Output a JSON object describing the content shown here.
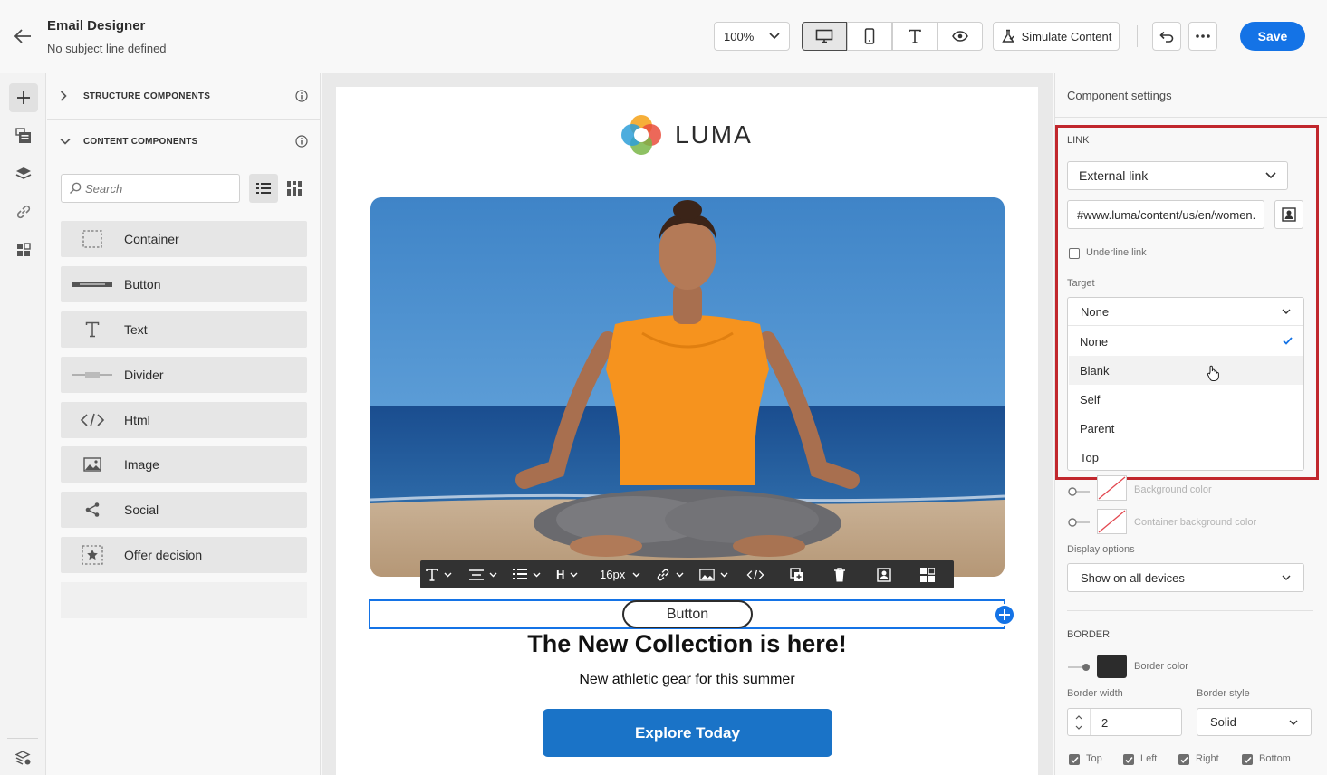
{
  "header": {
    "title": "Email Designer",
    "subtitle": "No subject line defined",
    "zoom": "100%",
    "simulate_label": "Simulate Content",
    "save_label": "Save"
  },
  "components_panel": {
    "structure_title": "STRUCTURE COMPONENTS",
    "content_title": "CONTENT COMPONENTS",
    "search_placeholder": "Search",
    "items": [
      {
        "label": "Container",
        "icon": "container-icon"
      },
      {
        "label": "Button",
        "icon": "button-icon"
      },
      {
        "label": "Text",
        "icon": "text-icon"
      },
      {
        "label": "Divider",
        "icon": "divider-icon"
      },
      {
        "label": "Html",
        "icon": "code-icon"
      },
      {
        "label": "Image",
        "icon": "image-icon"
      },
      {
        "label": "Social",
        "icon": "share-icon"
      },
      {
        "label": "Offer decision",
        "icon": "offer-icon"
      }
    ]
  },
  "email": {
    "brand": "LUMA",
    "button_text": "Button",
    "headline": "The New Collection is here!",
    "subline": "New athletic gear for this summer",
    "cta": "Explore Today",
    "toolbar_font_size": "16px",
    "toolbar_heading": "H"
  },
  "settings": {
    "panel_title": "Component settings",
    "link_section": "LINK",
    "link_type": "External link",
    "url_value": "#www.luma/content/us/en/women.",
    "underline_label": "Underline link",
    "target_label": "Target",
    "target_selected": "None",
    "target_options": [
      "None",
      "Blank",
      "Self",
      "Parent",
      "Top"
    ],
    "bg_color_label": "Background color",
    "container_bg_label": "Container background color",
    "display_options_label": "Display options",
    "display_options_value": "Show on all devices",
    "border_section": "BORDER",
    "border_color_label": "Border color",
    "border_width_label": "Border width",
    "border_width_value": "2",
    "border_style_label": "Border style",
    "border_style_value": "Solid",
    "sides": [
      "Top",
      "Left",
      "Right",
      "Bottom"
    ]
  },
  "colors": {
    "accent": "#1473e6",
    "highlight": "#c1272d",
    "cta": "#1a73c7",
    "border_swatch": "#2c2c2c"
  }
}
